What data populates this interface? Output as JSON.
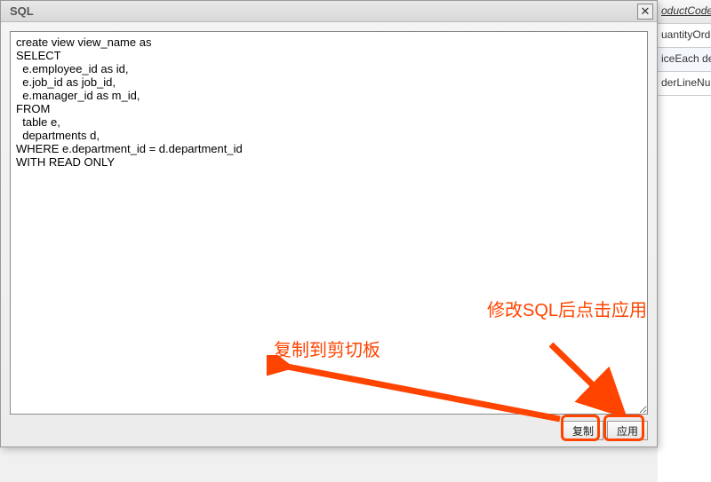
{
  "dialog": {
    "title": "SQL",
    "sql_text": "create view view_name as\nSELECT\n  e.employee_id as id,\n  e.job_id as job_id,\n  e.manager_id as m_id,\nFROM\n  table e,\n  departments d,\nWHERE e.department_id = d.department_id\nWITH READ ONLY",
    "buttons": {
      "copy": "复制",
      "apply": "应用"
    }
  },
  "annotations": {
    "copy_label": "复制到剪切板",
    "apply_label": "修改SQL后点击应用"
  },
  "background_rows": [
    "oductCode va",
    "uantityOrderec",
    "iceEach decim",
    "derLineNumbe"
  ]
}
